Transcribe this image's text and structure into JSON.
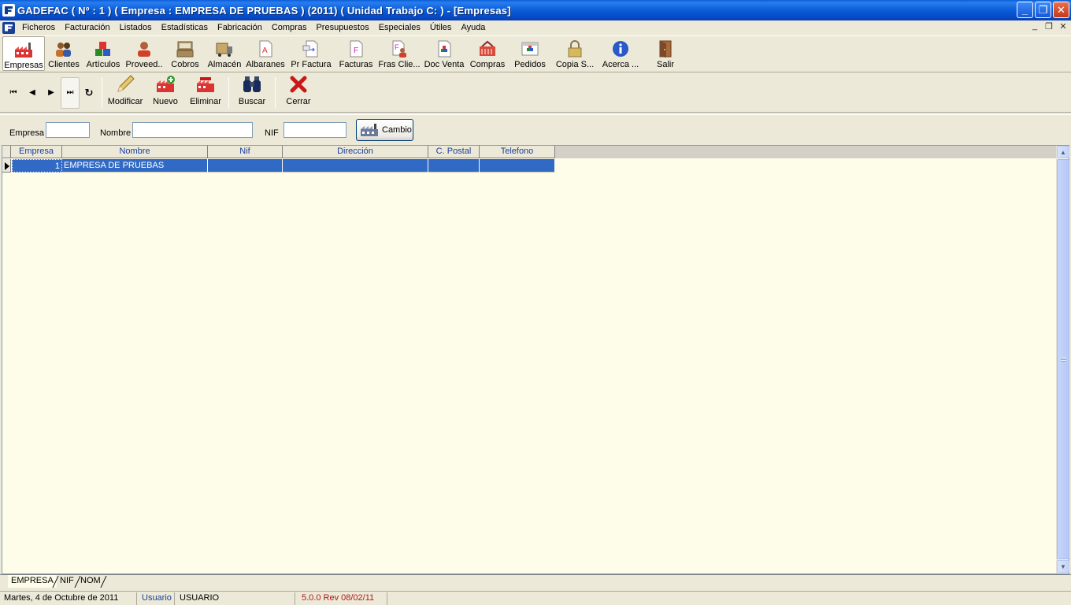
{
  "window": {
    "title": "GADEFAC ( Nº : 1 ) ( Empresa : EMPRESA DE PRUEBAS ) (2011) ( Unidad Trabajo C: ) - [Empresas]",
    "min_glyph": "_",
    "max_glyph": "❐",
    "close_glyph": "✕"
  },
  "menu": {
    "items": [
      "Ficheros",
      "Facturación",
      "Listados",
      "Estadísticas",
      "Fabricación",
      "Compras",
      "Presupuestos",
      "Especiales",
      "Útiles",
      "Ayuda"
    ],
    "mdi_min": "_",
    "mdi_restore": "❐",
    "mdi_close": "✕"
  },
  "toolbar": {
    "buttons": [
      {
        "label": "Empresas",
        "icon": "factory-icon"
      },
      {
        "label": "Clientes",
        "icon": "clients-icon"
      },
      {
        "label": "Artículos",
        "icon": "articles-icon"
      },
      {
        "label": "Proveed..",
        "icon": "supplier-icon"
      },
      {
        "label": "Cobros",
        "icon": "cash-register-icon"
      },
      {
        "label": "Almacén",
        "icon": "truck-icon"
      },
      {
        "label": "Albaranes",
        "icon": "delivery-note-icon"
      },
      {
        "label": "Pr Factura",
        "icon": "pre-invoice-icon"
      },
      {
        "label": "Facturas",
        "icon": "invoice-icon"
      },
      {
        "label": "Fras Clie...",
        "icon": "client-invoice-icon"
      },
      {
        "label": "Doc Venta",
        "icon": "sales-doc-icon"
      },
      {
        "label": "Compras",
        "icon": "basket-icon"
      },
      {
        "label": "Pedidos",
        "icon": "orders-icon"
      },
      {
        "label": "Copia S...",
        "icon": "padlock-icon"
      },
      {
        "label": "Acerca ...",
        "icon": "info-icon"
      },
      {
        "label": "Salir",
        "icon": "exit-door-icon"
      }
    ]
  },
  "navbar": {
    "first": "⏮",
    "prev": "◀",
    "next": "▶",
    "last": "⏭",
    "refresh": "↻",
    "modify_label": "Modificar",
    "new_label": "Nuevo",
    "delete_label": "Eliminar",
    "search_label": "Buscar",
    "close_label": "Cerrar"
  },
  "search": {
    "empresa_label": "Empresa",
    "empresa_value": "",
    "nombre_label": "Nombre",
    "nombre_value": "",
    "nif_label": "NIF",
    "nif_value": "",
    "cambio_label": "Cambio"
  },
  "grid": {
    "columns": [
      "Empresa",
      "Nombre",
      "Nif",
      "Dirección",
      "C. Postal",
      "Telefono"
    ],
    "rows": [
      {
        "empresa": "1",
        "nombre": "EMPRESA DE PRUEBAS",
        "nif": "",
        "direccion": "",
        "cpostal": "",
        "telefono": ""
      }
    ],
    "selection_color": "#316ac5",
    "background_color": "#fefde9"
  },
  "tabs": [
    "EMPRESA",
    "NIF",
    "NOM"
  ],
  "status": {
    "date": "Martes, 4 de Octubre de 2011",
    "user_label": "Usuario",
    "user_value": "USUARIO",
    "version": "5.0.0 Rev 08/02/11"
  }
}
